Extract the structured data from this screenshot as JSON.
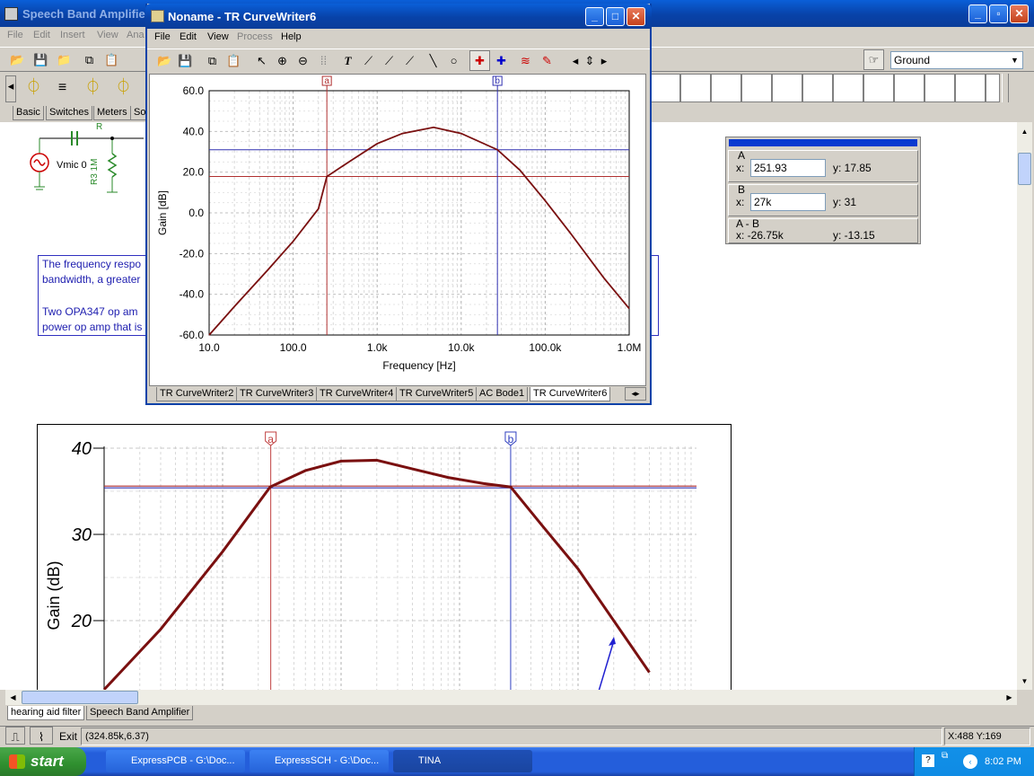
{
  "main_window": {
    "title": "Speech Band Amplifier",
    "menu": [
      "File",
      "Edit",
      "Insert",
      "View",
      "Ana"
    ],
    "ground_select": "Ground",
    "component_tabs": [
      "Basic",
      "Switches",
      "Meters",
      "So"
    ],
    "text_box": {
      "line1": "The frequency respo",
      "line2": "bandwidth, a greater",
      "line3": "Two OPA347 op am",
      "line4": "power op amp that is"
    },
    "schematic_labels": {
      "source": "Vmic 0",
      "resistor": "R3 1M",
      "r_top": "R"
    },
    "sheet_tabs": [
      "hearing aid filter",
      "Speech Band Amplifier"
    ],
    "status_coords": "(324.85k,6.37)",
    "status_xy": "X:488 Y:169",
    "exit_label": "Exit"
  },
  "curve_window": {
    "title": "Noname - TR CurveWriter6",
    "menu": [
      "File",
      "Edit",
      "View",
      "Process",
      "Help"
    ],
    "bottom_tabs": [
      "TR CurveWriter2",
      "TR CurveWriter3",
      "TR CurveWriter4",
      "TR CurveWriter5",
      "AC Bode1",
      "TR CurveWriter6"
    ]
  },
  "cursor_panel": {
    "a_label": "A",
    "a_x_label": "x:",
    "a_x": "251.93",
    "a_y": "y: 17.85",
    "b_label": "B",
    "b_x_label": "x:",
    "b_x": "27k",
    "b_y": "y: 31",
    "ab_label": "A - B",
    "ab_x": "x:  -26.75k",
    "ab_y": "y: -13.15"
  },
  "chart_data": [
    {
      "type": "line",
      "xlabel": "Frequency [Hz]",
      "ylabel": "Gain [dB]",
      "x_scale": "log",
      "xlim": [
        10,
        1000000
      ],
      "ylim": [
        -60,
        60
      ],
      "x_tick_labels": [
        "10.0",
        "100.0",
        "1.0k",
        "10.0k",
        "100.0k",
        "1.0M"
      ],
      "y_tick_labels": [
        "60.0",
        "40.0",
        "20.0",
        "0.0",
        "-20.0",
        "-40.0",
        "-60.0"
      ],
      "grid": true,
      "cursors": [
        {
          "label": "a",
          "x": 251.93,
          "y": 17.85
        },
        {
          "label": "b",
          "x": 27000,
          "y": 31
        }
      ],
      "x": [
        10,
        20,
        50,
        100,
        200,
        251.93,
        500,
        1000,
        2000,
        4700,
        10000,
        27000,
        50000,
        100000,
        200000,
        500000,
        1000000
      ],
      "y": [
        -60,
        -46,
        -28,
        -14,
        2,
        17.85,
        26,
        34,
        39,
        42,
        39,
        31,
        21,
        6,
        -10,
        -32,
        -47
      ]
    },
    {
      "type": "line",
      "ylabel": "Gain (dB)",
      "x_scale": "log",
      "ylim": [
        15,
        40
      ],
      "y_tick_labels": [
        "40",
        "30",
        "20"
      ],
      "grid": true,
      "cursors": [
        {
          "label": "a"
        },
        {
          "label": "b"
        }
      ],
      "x": [
        10,
        30,
        100,
        251.93,
        500,
        1000,
        2000,
        4000,
        8000,
        16000,
        27000,
        50000,
        100000,
        200000,
        400000
      ],
      "y": [
        12,
        19,
        28,
        35.5,
        37.4,
        38.5,
        38.6,
        37.6,
        36.6,
        35.9,
        35.5,
        31,
        26,
        20,
        14
      ]
    }
  ]
}
